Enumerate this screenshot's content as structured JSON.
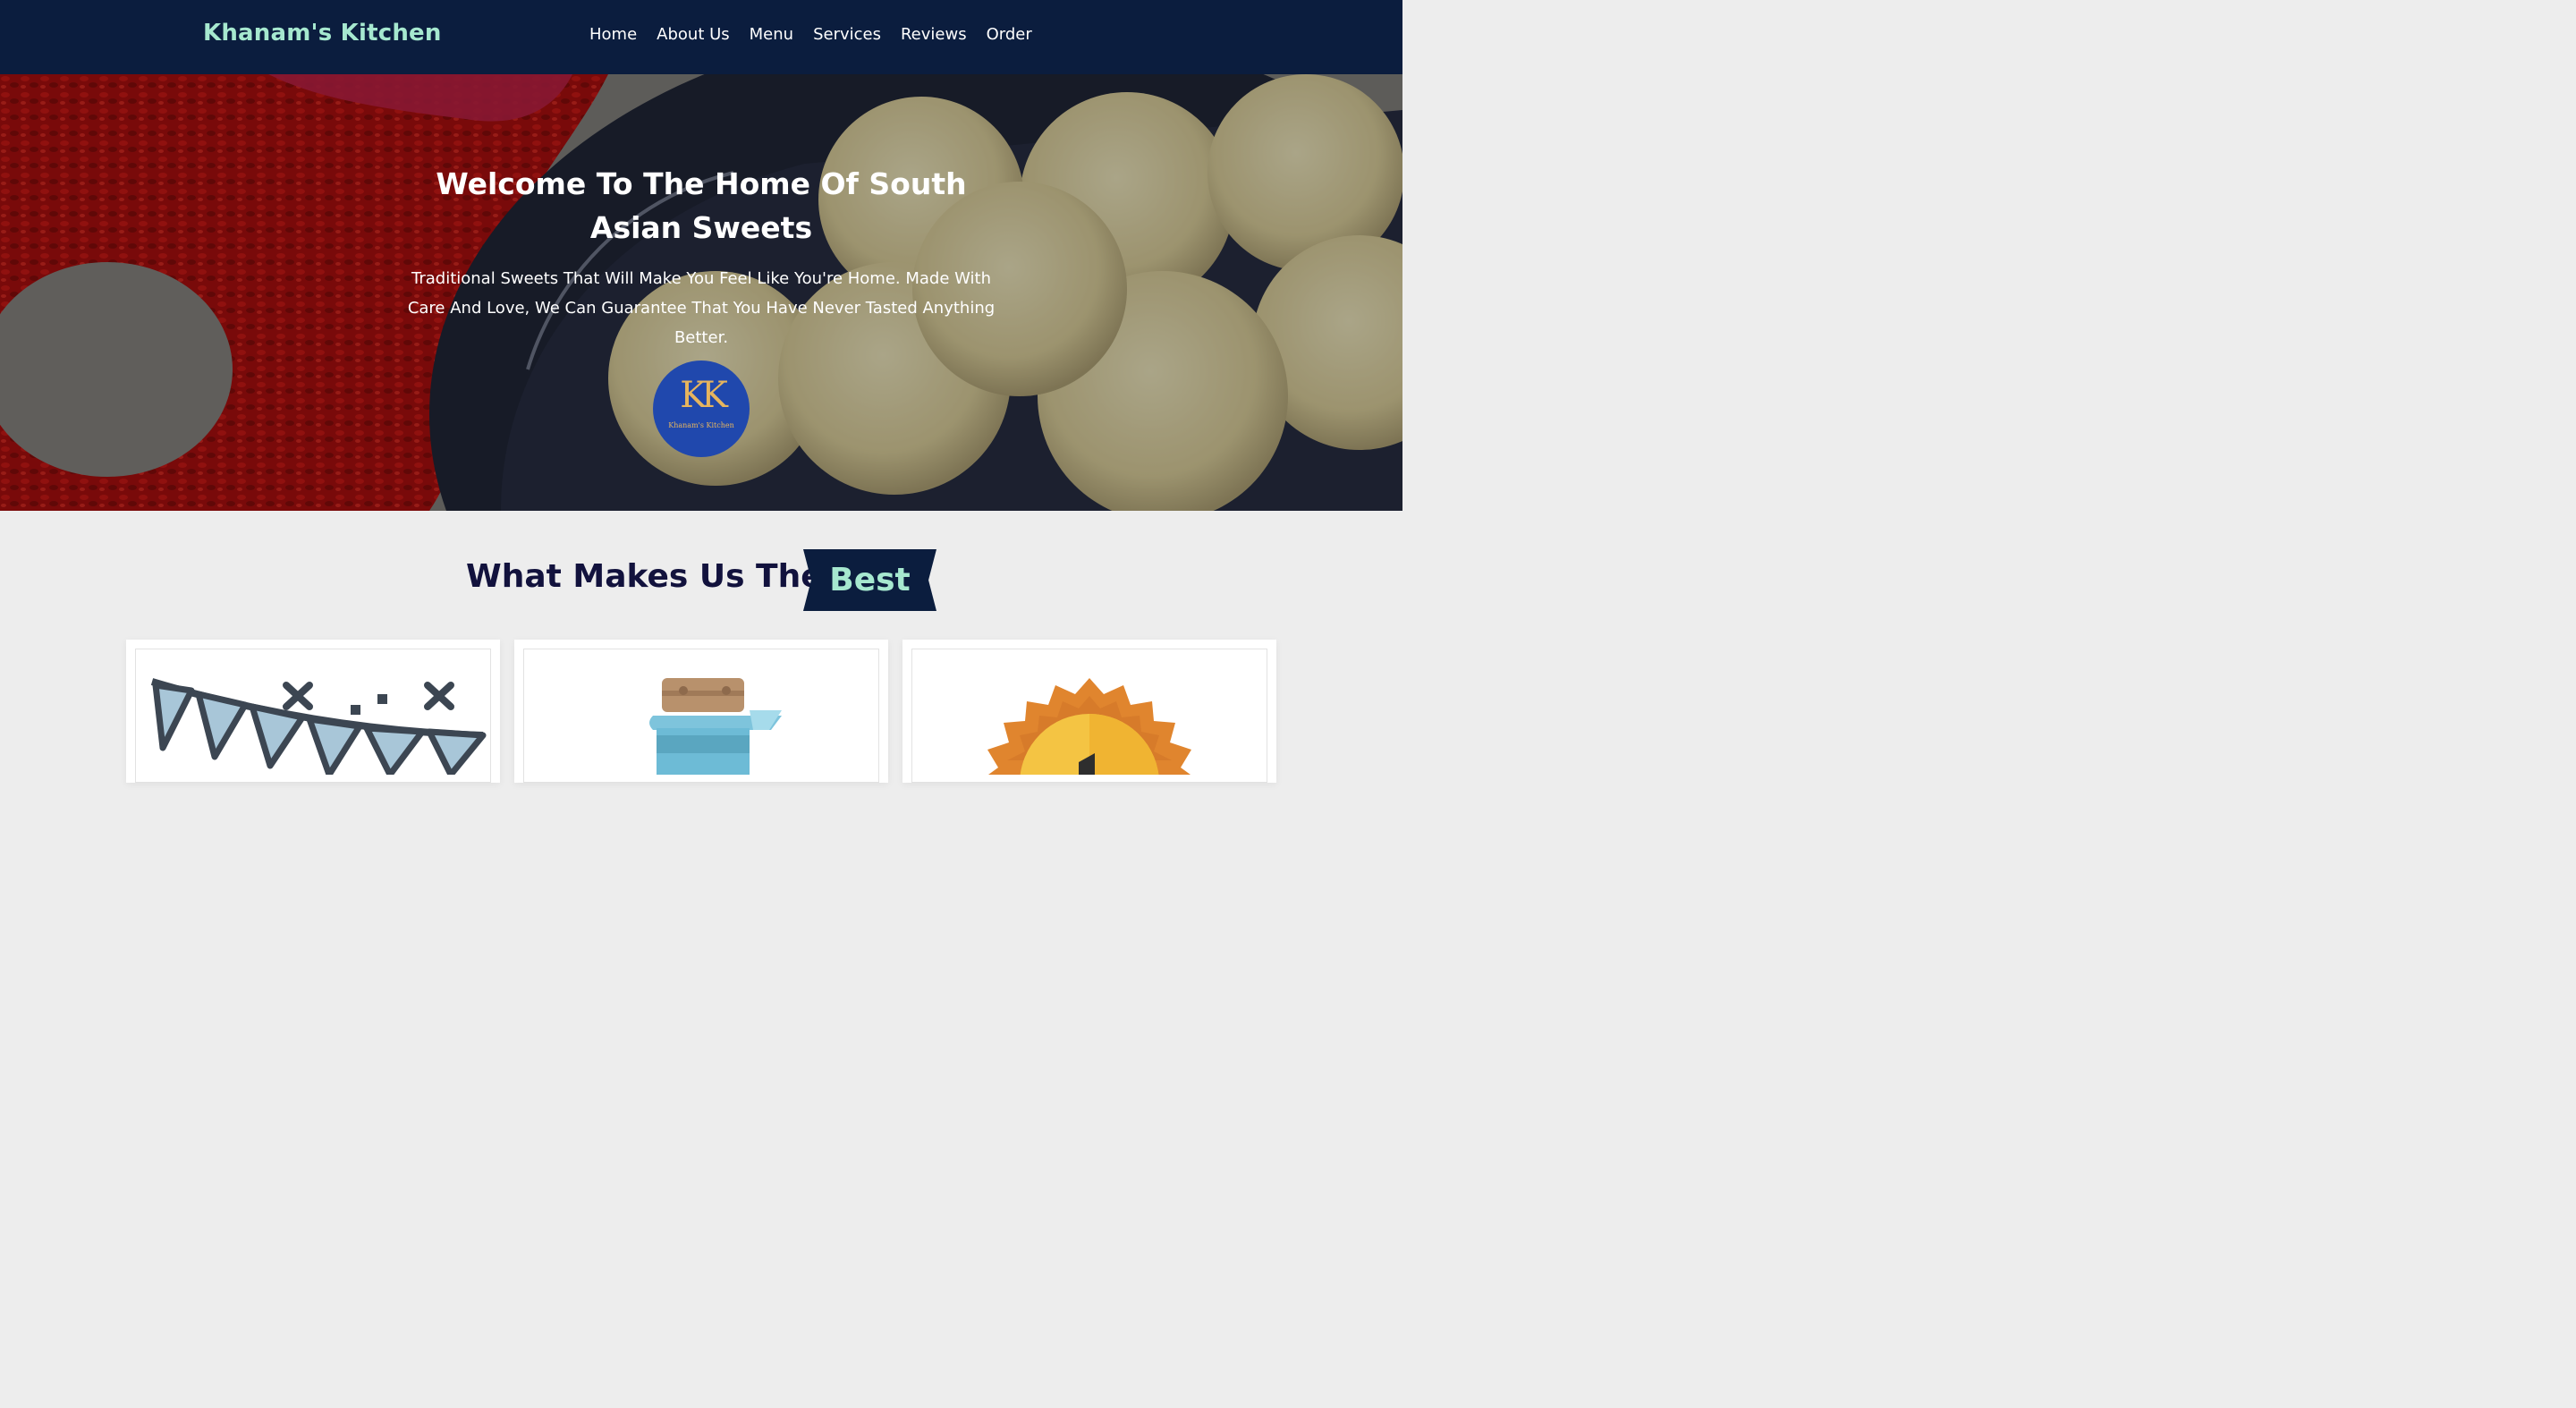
{
  "brand": "Khanam's Kitchen",
  "nav": {
    "items": [
      {
        "label": "Home"
      },
      {
        "label": "About Us"
      },
      {
        "label": "Menu"
      },
      {
        "label": "Services"
      },
      {
        "label": "Reviews"
      },
      {
        "label": "Order"
      }
    ]
  },
  "hero": {
    "title": "Welcome To The Home Of South Asian Sweets",
    "subtitle": "Traditional Sweets That Will Make You Feel Like You're Home. Made With Care And Love, We Can Guarantee That You Have Never Tasted Anything Better.",
    "logo_mark": "KK",
    "logo_text": "Khanam's Kitchen"
  },
  "section": {
    "title_main": "What Makes Us The",
    "title_highlight": "Best"
  },
  "cards": [
    {
      "icon": "party-bunting-icon"
    },
    {
      "icon": "jar-icon"
    },
    {
      "icon": "award-medal-icon"
    }
  ],
  "colors": {
    "nav_bg": "#0b1d3e",
    "accent": "#a6e8cf",
    "heading": "#12123d",
    "logo_bg": "#2048ad",
    "logo_gold": "#e6b55e"
  }
}
